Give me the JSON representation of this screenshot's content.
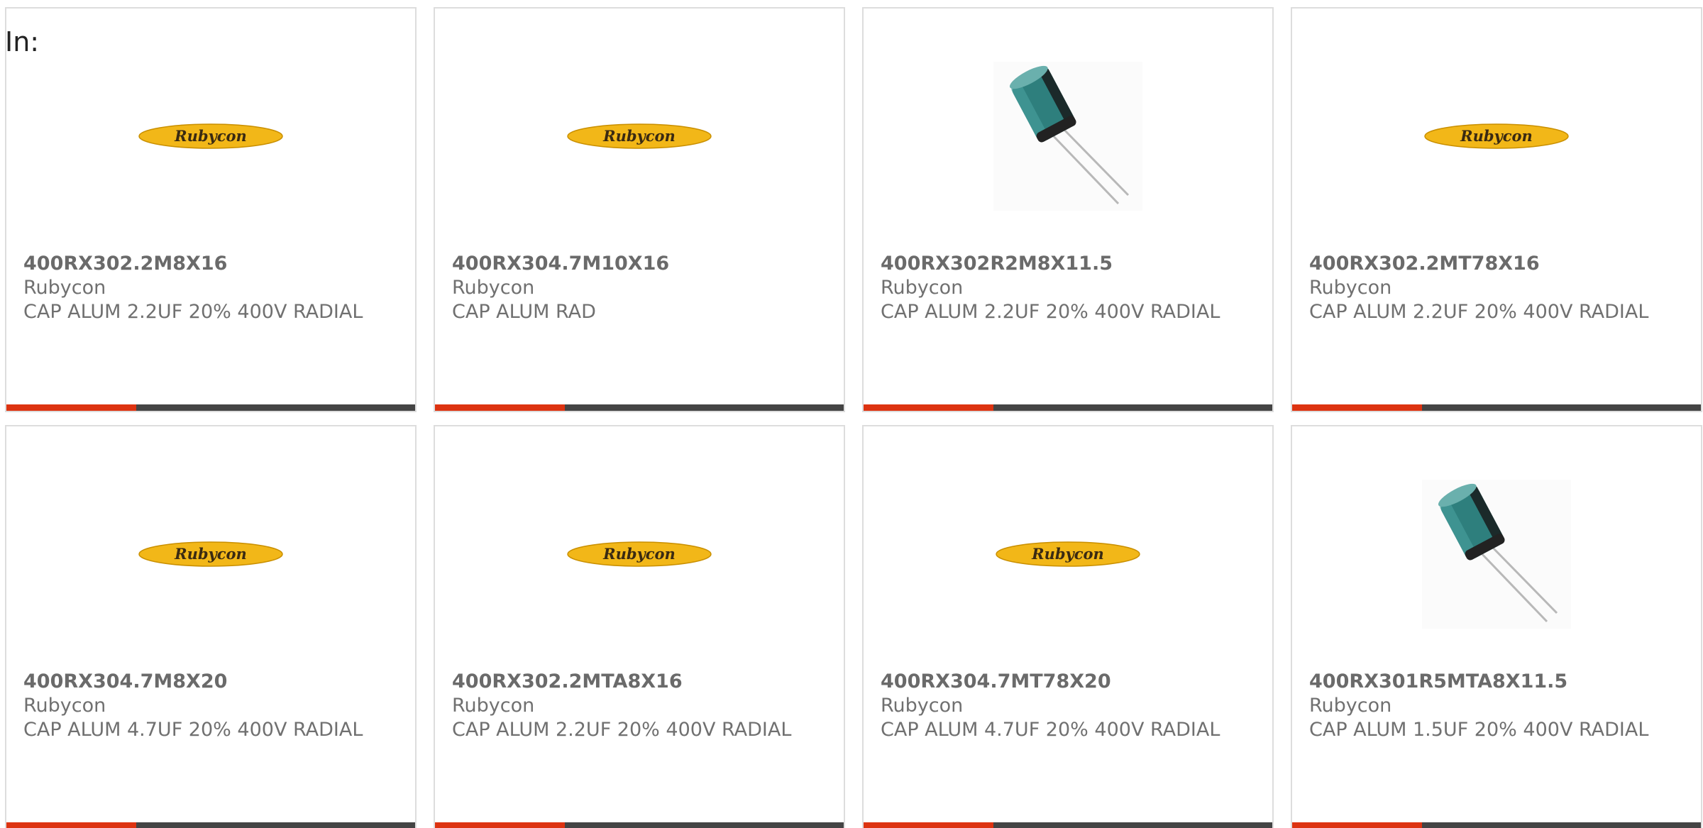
{
  "header": {
    "label": "In:"
  },
  "colors": {
    "accent": "#dd3311",
    "bar_dark": "#444444",
    "logo_yellow": "#f2b718",
    "capacitor_teal": "#2e7f7d"
  },
  "products": [
    {
      "part_number": "400RX302.2M8X16",
      "manufacturer": "Rubycon",
      "description": "CAP ALUM 2.2UF 20% 400V RADIAL",
      "image": "rubycon-logo",
      "logo_text": "Rubycon"
    },
    {
      "part_number": "400RX304.7M10X16",
      "manufacturer": "Rubycon",
      "description": "CAP ALUM RAD",
      "image": "rubycon-logo",
      "logo_text": "Rubycon"
    },
    {
      "part_number": "400RX302R2M8X11.5",
      "manufacturer": "Rubycon",
      "description": "CAP ALUM 2.2UF 20% 400V RADIAL",
      "image": "capacitor-photo",
      "logo_text": ""
    },
    {
      "part_number": "400RX302.2MT78X16",
      "manufacturer": "Rubycon",
      "description": "CAP ALUM 2.2UF 20% 400V RADIAL",
      "image": "rubycon-logo",
      "logo_text": "Rubycon"
    },
    {
      "part_number": "400RX304.7M8X20",
      "manufacturer": "Rubycon",
      "description": "CAP ALUM 4.7UF 20% 400V RADIAL",
      "image": "rubycon-logo",
      "logo_text": "Rubycon"
    },
    {
      "part_number": "400RX302.2MTA8X16",
      "manufacturer": "Rubycon",
      "description": "CAP ALUM 2.2UF 20% 400V RADIAL",
      "image": "rubycon-logo",
      "logo_text": "Rubycon"
    },
    {
      "part_number": "400RX304.7MT78X20",
      "manufacturer": "Rubycon",
      "description": "CAP ALUM 4.7UF 20% 400V RADIAL",
      "image": "rubycon-logo",
      "logo_text": "Rubycon"
    },
    {
      "part_number": "400RX301R5MTA8X11.5",
      "manufacturer": "Rubycon",
      "description": "CAP ALUM 1.5UF 20% 400V RADIAL",
      "image": "capacitor-photo",
      "logo_text": ""
    }
  ]
}
